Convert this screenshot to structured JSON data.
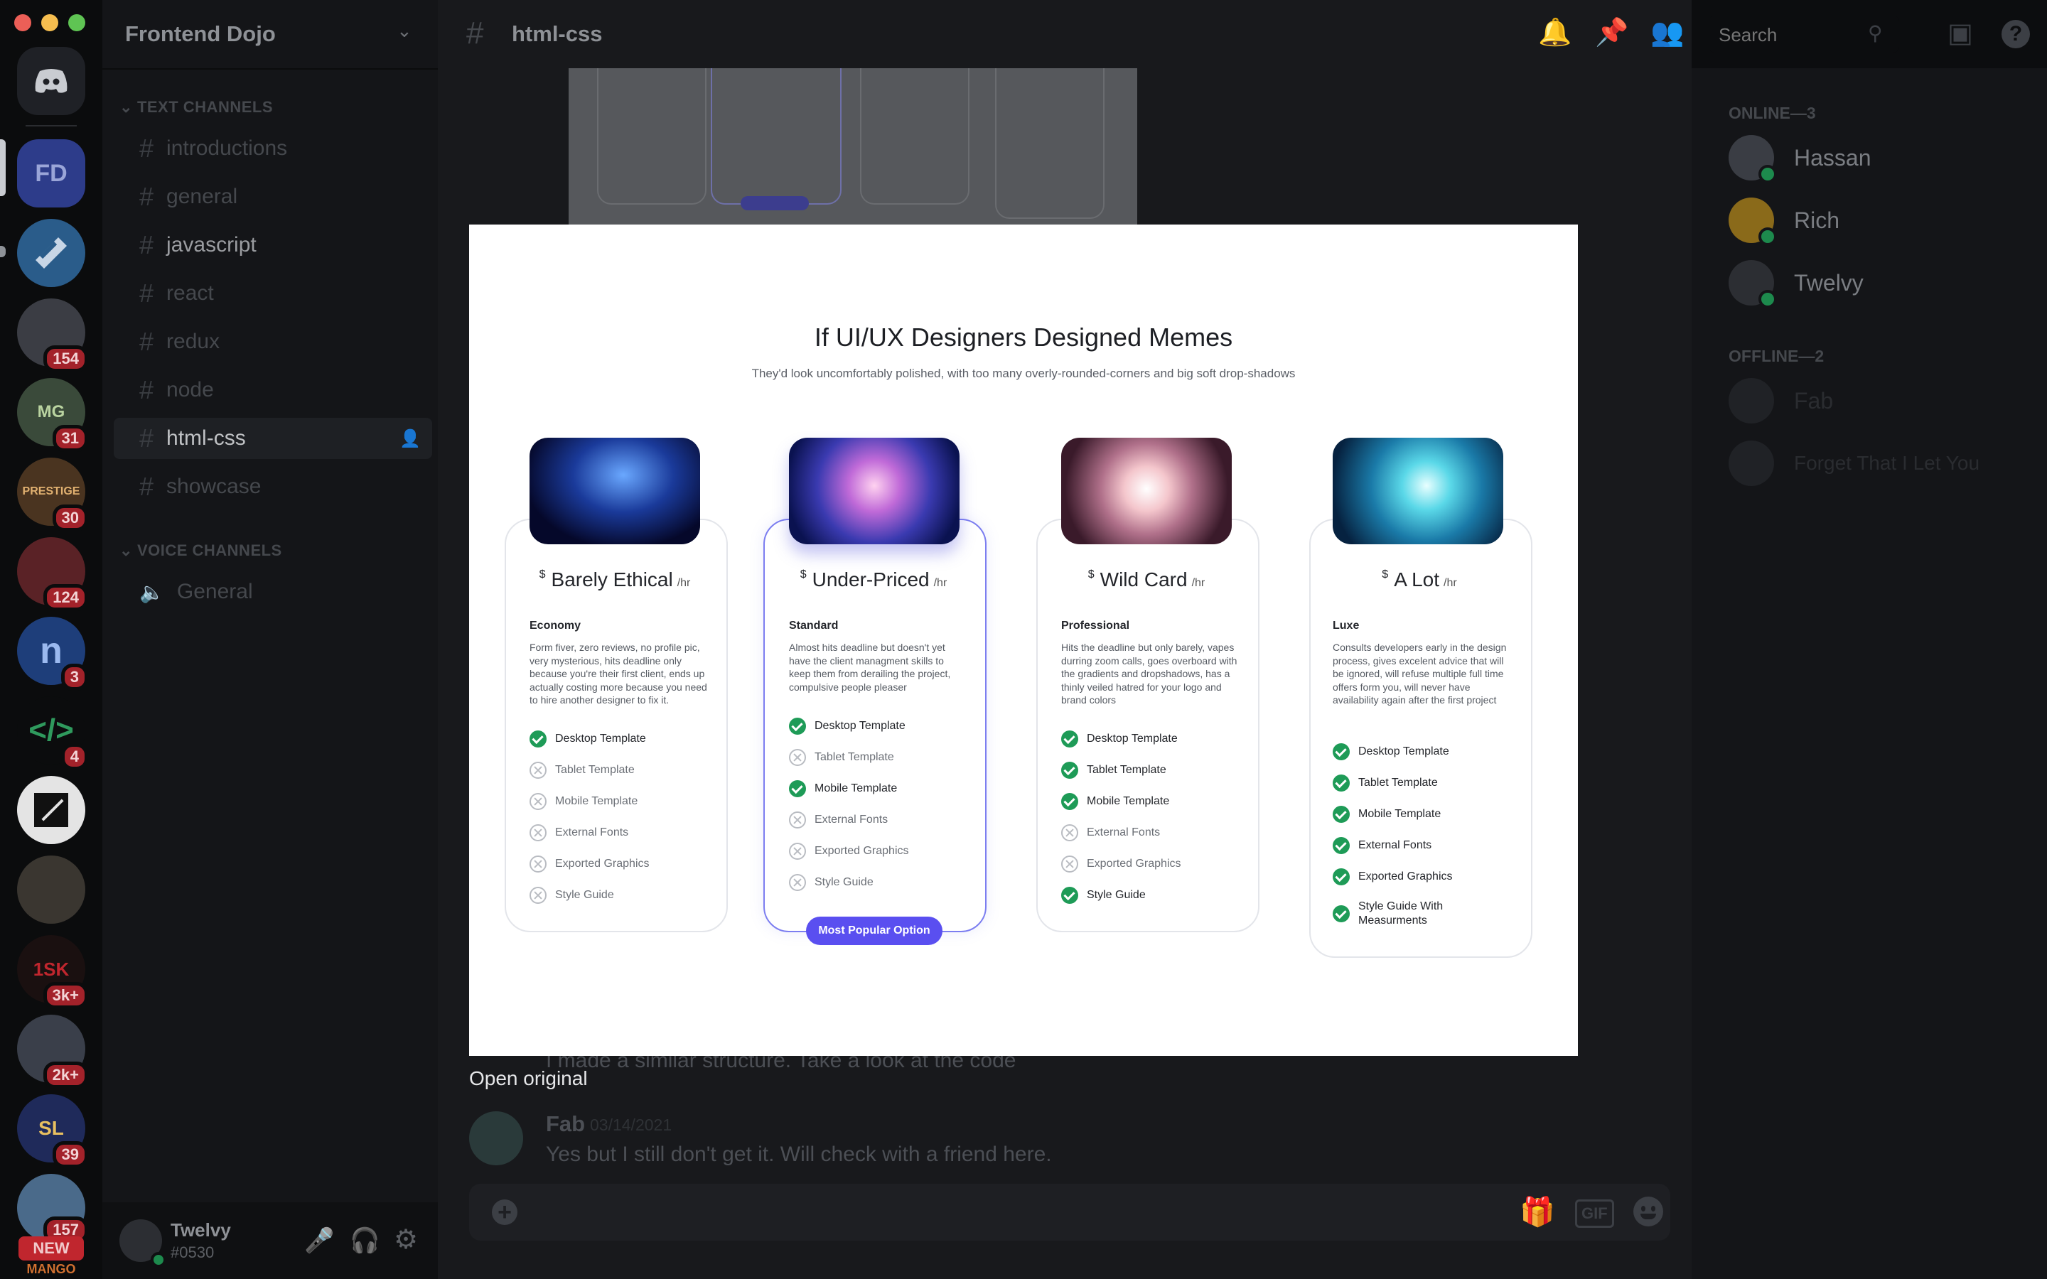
{
  "window": {
    "traffic_colors": [
      "#ec5f57",
      "#f6be4f",
      "#5fc453"
    ]
  },
  "server": {
    "name": "Frontend Dojo",
    "abbrev": "FD"
  },
  "server_badges": [
    "154",
    "31",
    "30",
    "124",
    "3",
    "4",
    "3k+",
    "2k+",
    "39",
    "157"
  ],
  "new_badge": "NEW",
  "mango_label": "MANGO",
  "categories": {
    "text": "TEXT CHANNELS",
    "voice": "VOICE CHANNELS"
  },
  "channels": [
    "introductions",
    "general",
    "javascript",
    "react",
    "redux",
    "node",
    "html-css",
    "showcase"
  ],
  "voice_channel": "General",
  "active_channel": "html-css",
  "search": {
    "placeholder": "Search"
  },
  "members": {
    "online_header": "ONLINE—3",
    "online": [
      "Hassan",
      "Rich",
      "Twelvy"
    ],
    "offline_header": "OFFLINE—2",
    "offline": [
      "Fab",
      "Forget That I Let You"
    ]
  },
  "user": {
    "name": "Twelvy",
    "tag": "#0530"
  },
  "modal": {
    "title": "If UI/UX Designers Designed Memes",
    "subtitle": "They'd look uncomfortably polished, with too many overly-rounded-corners and big soft drop-shadows",
    "currency": "$",
    "per": "/hr",
    "popular_label": "Most Popular Option",
    "cards": [
      {
        "name": "Barely Ethical",
        "tier": "Economy",
        "desc": "Form fiver, zero reviews, no profile pic, very mysterious, hits deadline only because you're their first client, ends up actually costing more because you need to hire another designer to fix it.",
        "features": [
          [
            "Desktop Template",
            true
          ],
          [
            "Tablet Template",
            false
          ],
          [
            "Mobile Template",
            false
          ],
          [
            "External Fonts",
            false
          ],
          [
            "Exported Graphics",
            false
          ],
          [
            "Style Guide",
            false
          ]
        ]
      },
      {
        "name": "Under-Priced",
        "tier": "Standard",
        "desc": "Almost hits deadline but doesn't yet have the client managment skills to keep them from derailing the project, compulsive people pleaser",
        "features": [
          [
            "Desktop Template",
            true
          ],
          [
            "Tablet Template",
            false
          ],
          [
            "Mobile Template",
            true
          ],
          [
            "External Fonts",
            false
          ],
          [
            "Exported Graphics",
            false
          ],
          [
            "Style Guide",
            false
          ]
        ]
      },
      {
        "name": "Wild Card",
        "tier": "Professional",
        "desc": "Hits the deadline but only barely, vapes durring zoom calls, goes overboard with the gradients and dropshadows, has a thinly veiled hatred for your logo and brand colors",
        "features": [
          [
            "Desktop Template",
            true
          ],
          [
            "Tablet Template",
            true
          ],
          [
            "Mobile Template",
            true
          ],
          [
            "External Fonts",
            false
          ],
          [
            "Exported Graphics",
            false
          ],
          [
            "Style Guide",
            true
          ]
        ]
      },
      {
        "name": "A Lot",
        "tier": "Luxe",
        "desc": "Consults developers early in the design process, gives excelent advice that will be ignored, will refuse multiple full time offers form you, will never have availability again after the first project",
        "features": [
          [
            "Desktop Template",
            true
          ],
          [
            "Tablet Template",
            true
          ],
          [
            "Mobile Template",
            true
          ],
          [
            "External Fonts",
            true
          ],
          [
            "Exported Graphics",
            true
          ],
          [
            "Style Guide With Measurments",
            true
          ]
        ]
      }
    ]
  },
  "open_original": "Open original",
  "chat": {
    "partial_message": "I made a similar structure. Take a look at the code",
    "author": "Fab",
    "date": "03/14/2021",
    "message": "Yes but I still don't get it. Will check with a friend here."
  },
  "composer": {
    "gif_label": "GIF"
  }
}
